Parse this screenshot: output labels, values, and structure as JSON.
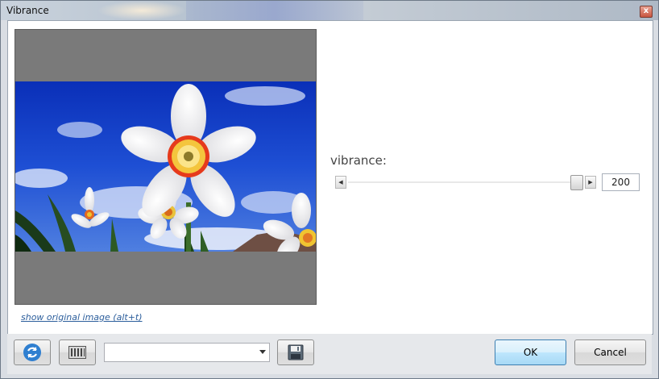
{
  "window": {
    "title": "Vibrance",
    "close_glyph": "x"
  },
  "preview": {
    "show_original_link": "show original image (alt+t)"
  },
  "vibrance": {
    "label": "vibrance:",
    "value": "200"
  },
  "toolbar": {
    "refresh_icon": "refresh-icon",
    "presets_icon": "presets-icon",
    "preset_select_value": "",
    "save_icon": "floppy-disk-icon"
  },
  "buttons": {
    "ok_label": "OK",
    "cancel_label": "Cancel"
  },
  "colors": {
    "accent": "#3c7fb1",
    "link": "#2c5e9c",
    "sky": "#1d46c8"
  }
}
